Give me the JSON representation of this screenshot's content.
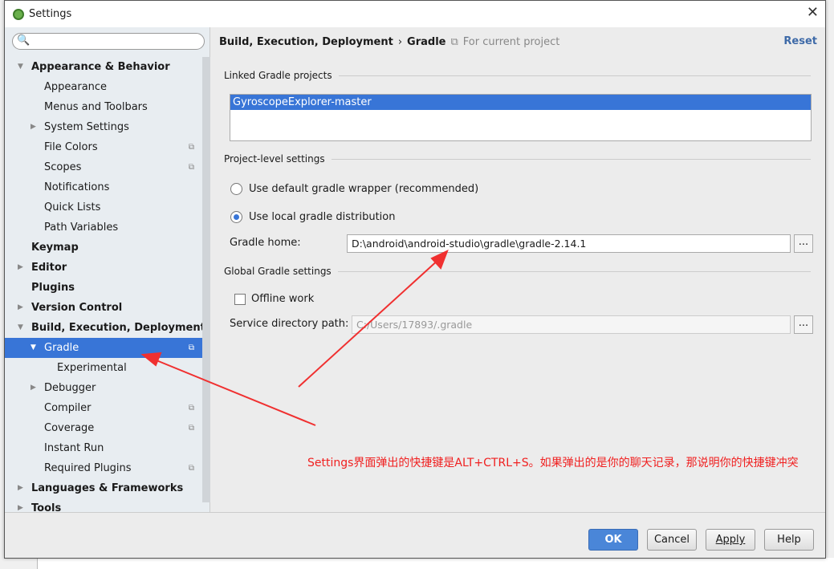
{
  "window": {
    "title": "Settings",
    "close": "✕"
  },
  "search": {
    "placeholder": "",
    "icon": "🔍"
  },
  "tree": [
    {
      "label": "Appearance & Behavior",
      "level": 0,
      "bold": true,
      "arrow": "▼"
    },
    {
      "label": "Appearance",
      "level": 1
    },
    {
      "label": "Menus and Toolbars",
      "level": 1
    },
    {
      "label": "System Settings",
      "level": 1,
      "arrow": "▶"
    },
    {
      "label": "File Colors",
      "level": 1,
      "copy": true
    },
    {
      "label": "Scopes",
      "level": 1,
      "copy": true
    },
    {
      "label": "Notifications",
      "level": 1
    },
    {
      "label": "Quick Lists",
      "level": 1
    },
    {
      "label": "Path Variables",
      "level": 1
    },
    {
      "label": "Keymap",
      "level": 0,
      "bold": true
    },
    {
      "label": "Editor",
      "level": 0,
      "bold": true,
      "arrow": "▶"
    },
    {
      "label": "Plugins",
      "level": 0,
      "bold": true
    },
    {
      "label": "Version Control",
      "level": 0,
      "bold": true,
      "arrow": "▶"
    },
    {
      "label": "Build, Execution, Deployment",
      "level": 0,
      "bold": true,
      "arrow": "▼"
    },
    {
      "label": "Gradle",
      "level": 1,
      "arrow": "▼",
      "copy": true,
      "selected": true
    },
    {
      "label": "Experimental",
      "level": 2
    },
    {
      "label": "Debugger",
      "level": 1,
      "arrow": "▶"
    },
    {
      "label": "Compiler",
      "level": 1,
      "copy": true
    },
    {
      "label": "Coverage",
      "level": 1,
      "copy": true
    },
    {
      "label": "Instant Run",
      "level": 1
    },
    {
      "label": "Required Plugins",
      "level": 1,
      "copy": true
    },
    {
      "label": "Languages & Frameworks",
      "level": 0,
      "bold": true,
      "arrow": "▶"
    },
    {
      "label": "Tools",
      "level": 0,
      "bold": true,
      "arrow": "▶"
    }
  ],
  "header": {
    "crumb1": "Build, Execution, Deployment",
    "sep": "›",
    "crumb2": "Gradle",
    "scope_icon": "⧉",
    "scope": "For current project",
    "reset": "Reset"
  },
  "main": {
    "linked_title": "Linked Gradle projects",
    "projects": [
      "GyroscopeExplorer-master"
    ],
    "project_level_title": "Project-level settings",
    "radio_default": "Use default gradle wrapper (recommended)",
    "radio_local": "Use local gradle distribution",
    "selected_radio": "local",
    "gradle_home_label": "Gradle home:",
    "gradle_home": "D:\\android\\android-studio\\gradle\\gradle-2.14.1",
    "browse": "...",
    "global_title": "Global Gradle settings",
    "offline": "Offline work",
    "offline_checked": false,
    "service_label": "Service directory path:",
    "service_path": "C:/Users/17893/.gradle"
  },
  "footer": {
    "ok": "OK",
    "cancel": "Cancel",
    "apply": "Apply",
    "help": "Help"
  },
  "annotation": {
    "text": "Settings界面弹出的快捷键是ALT+CTRL+S。如果弹出的是你的聊天记录，那说明你的快捷键冲突",
    "color": "#f02020"
  }
}
